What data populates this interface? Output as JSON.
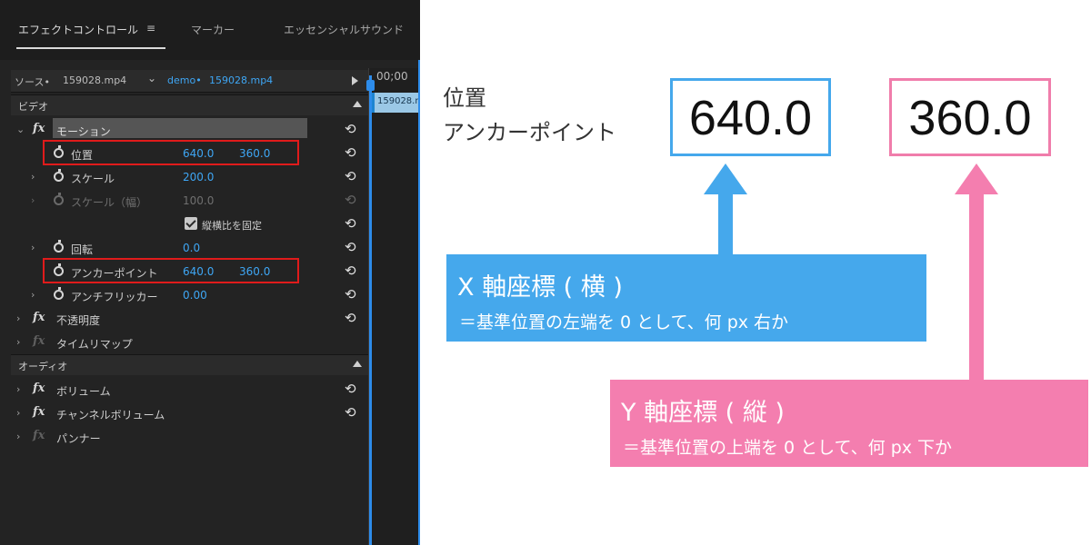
{
  "panel": {
    "tabs": [
      "エフェクトコントロール",
      "マーカー",
      "エッセンシャルサウンド"
    ],
    "menu_icon": "≡",
    "source_label": "ソース•",
    "source_file": "159028.mp4",
    "sequence_label": "demo•",
    "sequence_file": "159028.mp4",
    "timecode": "00;00",
    "timeline_clip": "159028.m",
    "video_section": "ビデオ",
    "audio_section": "オーディオ",
    "motion": "モーション",
    "position": {
      "label": "位置",
      "x": "640.0",
      "y": "360.0"
    },
    "scale": {
      "label": "スケール",
      "value": "200.0"
    },
    "scale_width": {
      "label": "スケール（幅）",
      "value": "100.0"
    },
    "uniform_scale": "縦横比を固定",
    "rotation": {
      "label": "回転",
      "value": "0.0"
    },
    "anchor_point": {
      "label": "アンカーポイント",
      "x": "640.0",
      "y": "360.0"
    },
    "anti_flicker": {
      "label": "アンチフリッカー",
      "value": "0.00"
    },
    "opacity": "不透明度",
    "time_remap": "タイムリマップ",
    "volume": "ボリューム",
    "channel_volume": "チャンネルボリューム",
    "panner": "パンナー",
    "fx": "fx",
    "chevron_right": "›",
    "chevron_down": "⌄",
    "reset": "⟲"
  },
  "explain": {
    "label_position": "位置",
    "label_anchor": "アンカーポイント",
    "x_value": "640.0",
    "y_value": "360.0",
    "x_title": "X 軸座標 ( 横 )",
    "x_desc": "＝基準位置の左端を 0 として、何 px 右か",
    "y_title": "Y 軸座標 ( 縦 )",
    "y_desc": "＝基準位置の上端を 0 として、何 px 下か"
  },
  "colors": {
    "accent_blue": "#45a8ec",
    "accent_pink": "#f47eaf",
    "value_blue": "#3ea6f4",
    "highlight_red": "#e01b1b"
  }
}
